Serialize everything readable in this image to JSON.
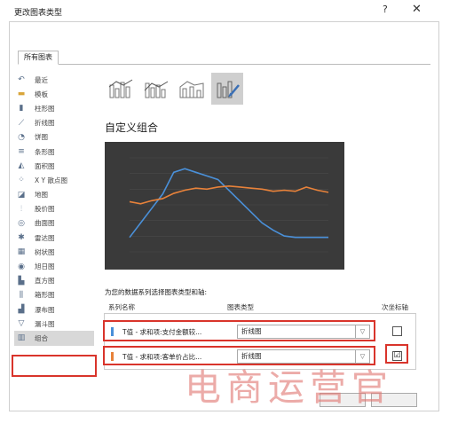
{
  "dialog": {
    "title": "更改图表类型",
    "help_label": "?",
    "close_label": "✕"
  },
  "tabs": [
    {
      "label": "所有图表"
    }
  ],
  "sidebar": {
    "items": [
      {
        "label": "最近",
        "icon": "recent-icon",
        "glyph": "↶"
      },
      {
        "label": "模板",
        "icon": "template-folder-icon",
        "glyph": "▬"
      },
      {
        "label": "柱形图",
        "icon": "column-chart-icon",
        "glyph": "▮"
      },
      {
        "label": "折线图",
        "icon": "line-chart-icon",
        "glyph": "⟋"
      },
      {
        "label": "饼图",
        "icon": "pie-chart-icon",
        "glyph": "◔"
      },
      {
        "label": "条形图",
        "icon": "bar-chart-icon",
        "glyph": "≡"
      },
      {
        "label": "面积图",
        "icon": "area-chart-icon",
        "glyph": "◭"
      },
      {
        "label": "X Y 散点图",
        "icon": "scatter-chart-icon",
        "glyph": "⁘"
      },
      {
        "label": "地图",
        "icon": "map-chart-icon",
        "glyph": "◪"
      },
      {
        "label": "股价图",
        "icon": "stock-chart-icon",
        "glyph": "⫶"
      },
      {
        "label": "曲面图",
        "icon": "surface-chart-icon",
        "glyph": "◎"
      },
      {
        "label": "雷达图",
        "icon": "radar-chart-icon",
        "glyph": "✱"
      },
      {
        "label": "树状图",
        "icon": "treemap-chart-icon",
        "glyph": "▦"
      },
      {
        "label": "旭日图",
        "icon": "sunburst-chart-icon",
        "glyph": "◉"
      },
      {
        "label": "直方图",
        "icon": "histogram-chart-icon",
        "glyph": "▙"
      },
      {
        "label": "箱形图",
        "icon": "box-whisker-chart-icon",
        "glyph": "⫼"
      },
      {
        "label": "瀑布图",
        "icon": "waterfall-chart-icon",
        "glyph": "▟"
      },
      {
        "label": "漏斗图",
        "icon": "funnel-chart-icon",
        "glyph": "▽"
      },
      {
        "label": "组合",
        "icon": "combo-chart-icon",
        "glyph": "▥"
      }
    ],
    "selected": "组合"
  },
  "main": {
    "section_title": "自定义组合",
    "series_prompt": "为您的数据系列选择图表类型和轴:",
    "table_headers": {
      "series_name": "系列名称",
      "chart_type": "图表类型",
      "secondary_axis": "次坐标轴"
    },
    "series_rows": [
      {
        "name": "T值 - 求和项:支付金额较...",
        "chart_type": "折线图",
        "secondary_axis": false,
        "color": "#4a90d9"
      },
      {
        "name": "T值 - 求和项:客单价占比...",
        "chart_type": "折线图",
        "secondary_axis": true,
        "color": "#e8823a"
      }
    ]
  },
  "watermark": "电商运营官",
  "colors": {
    "preview_bg": "#3a3a3a",
    "series_blue": "#4a90d9",
    "series_orange": "#e8823a",
    "highlight_red": "#d9342b"
  },
  "chart_data": {
    "type": "line",
    "title": "",
    "x": [
      1,
      2,
      3,
      4,
      5,
      6,
      7,
      8,
      9,
      10,
      11,
      12,
      13,
      14,
      15,
      16,
      17,
      18,
      19
    ],
    "series": [
      {
        "values": [
          2,
          4,
          6,
          8,
          11,
          11.5,
          11,
          10.5,
          10,
          8.5,
          7,
          5.5,
          4,
          3,
          2.2,
          2,
          2,
          2,
          2
        ],
        "axis": "primary"
      },
      {
        "values": [
          4.8,
          4.6,
          4.9,
          5.1,
          5.6,
          5.9,
          6.1,
          6.0,
          6.2,
          6.3,
          6.2,
          6.1,
          6.0,
          5.8,
          5.9,
          5.8,
          6.2,
          5.9,
          5.7
        ],
        "axis": "secondary"
      }
    ]
  }
}
